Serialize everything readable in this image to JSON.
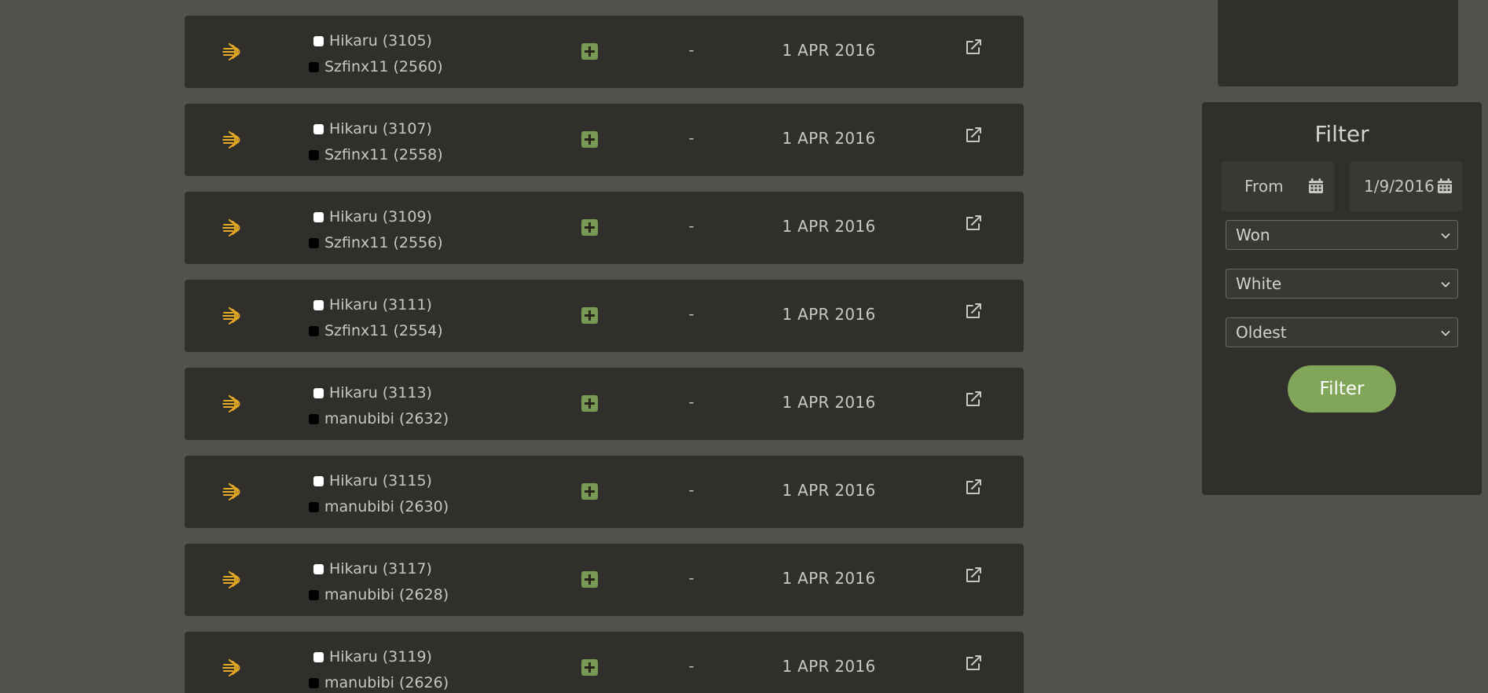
{
  "games": [
    {
      "white": "Hikaru (3105)",
      "black": "Szfinx11 (2560)",
      "moves": "-",
      "date": "1 APR 2016"
    },
    {
      "white": "Hikaru (3107)",
      "black": "Szfinx11 (2558)",
      "moves": "-",
      "date": "1 APR 2016"
    },
    {
      "white": "Hikaru (3109)",
      "black": "Szfinx11 (2556)",
      "moves": "-",
      "date": "1 APR 2016"
    },
    {
      "white": "Hikaru (3111)",
      "black": "Szfinx11 (2554)",
      "moves": "-",
      "date": "1 APR 2016"
    },
    {
      "white": "Hikaru (3113)",
      "black": "manubibi (2632)",
      "moves": "-",
      "date": "1 APR 2016"
    },
    {
      "white": "Hikaru (3115)",
      "black": "manubibi (2630)",
      "moves": "-",
      "date": "1 APR 2016"
    },
    {
      "white": "Hikaru (3117)",
      "black": "manubibi (2628)",
      "moves": "-",
      "date": "1 APR 2016"
    },
    {
      "white": "Hikaru (3119)",
      "black": "manubibi (2626)",
      "moves": "-",
      "date": "1 APR 2016"
    }
  ],
  "icons": {
    "speed": "bullet-speed-icon",
    "result": "win-plus-icon",
    "open": "external-link-icon",
    "calendar": "calendar-icon"
  },
  "colors": {
    "background": "#52514d",
    "card": "#312f2c",
    "accent_green": "#81a65a",
    "result_green": "#779954",
    "speed_gold": "#e3aa24"
  },
  "filter": {
    "title": "Filter",
    "from_placeholder": "From",
    "to_value": "1/9/2016",
    "result_selected": "Won",
    "color_selected": "White",
    "order_selected": "Oldest",
    "button_label": "Filter"
  }
}
